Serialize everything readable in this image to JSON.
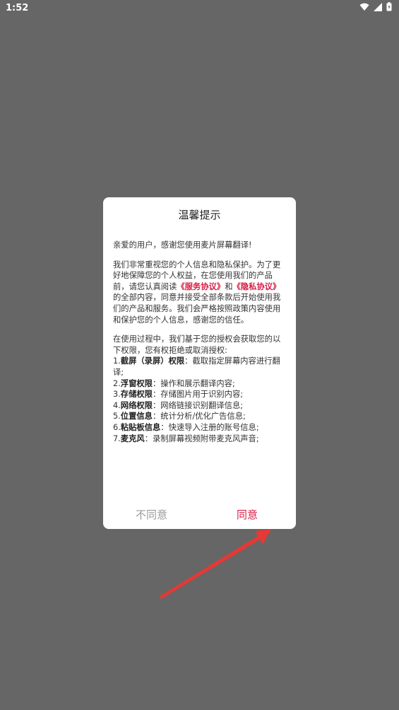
{
  "status_bar": {
    "time": "1:52"
  },
  "dialog": {
    "title": "温馨提示",
    "greeting": "亲爱的用户，感谢您使用麦片屏幕翻译!",
    "intro_1": "我们非常重视您的个人信息和隐私保护。为了更好地保障您的个人权益，在您使用我们的产品前，请您认真阅读",
    "service_link": "《服务协议》",
    "and_text": "和",
    "privacy_link": "《隐私协议》",
    "intro_2": "的全部内容，同意并接受全部条款后开始使用我们的产品和服务。我们会严格按照政策内容使用和保护您的个人信息，感谢您的信任。",
    "perm_intro": "在使用过程中，我们基于您的授权会获取您的以下权限，您有权拒绝或取消授权:",
    "permissions": [
      {
        "index": "1.",
        "name": "截屏（录屏）权限",
        "desc": "：截取指定屏幕内容进行翻译;"
      },
      {
        "index": "2.",
        "name": "浮窗权限",
        "desc": "：操作和展示翻译内容;"
      },
      {
        "index": "3.",
        "name": "存储权限",
        "desc": "：存储图片用于识别内容;"
      },
      {
        "index": "4.",
        "name": "网络权限",
        "desc": "：网络链接识别翻译信息;"
      },
      {
        "index": "5.",
        "name": "位置信息",
        "desc": "：统计分析/优化广告信息;"
      },
      {
        "index": "6.",
        "name": "粘贴板信息",
        "desc": "：快速导入注册的账号信息;"
      },
      {
        "index": "7.",
        "name": "麦克风",
        "desc": "：录制屏幕视频附带麦克风声音;"
      }
    ],
    "disagree_label": "不同意",
    "agree_label": "同意"
  },
  "colors": {
    "overlay": "#666666",
    "accent": "#d81b43",
    "arrow": "#e53935"
  },
  "icons": [
    "wifi-icon",
    "signal-icon",
    "battery-icon"
  ]
}
